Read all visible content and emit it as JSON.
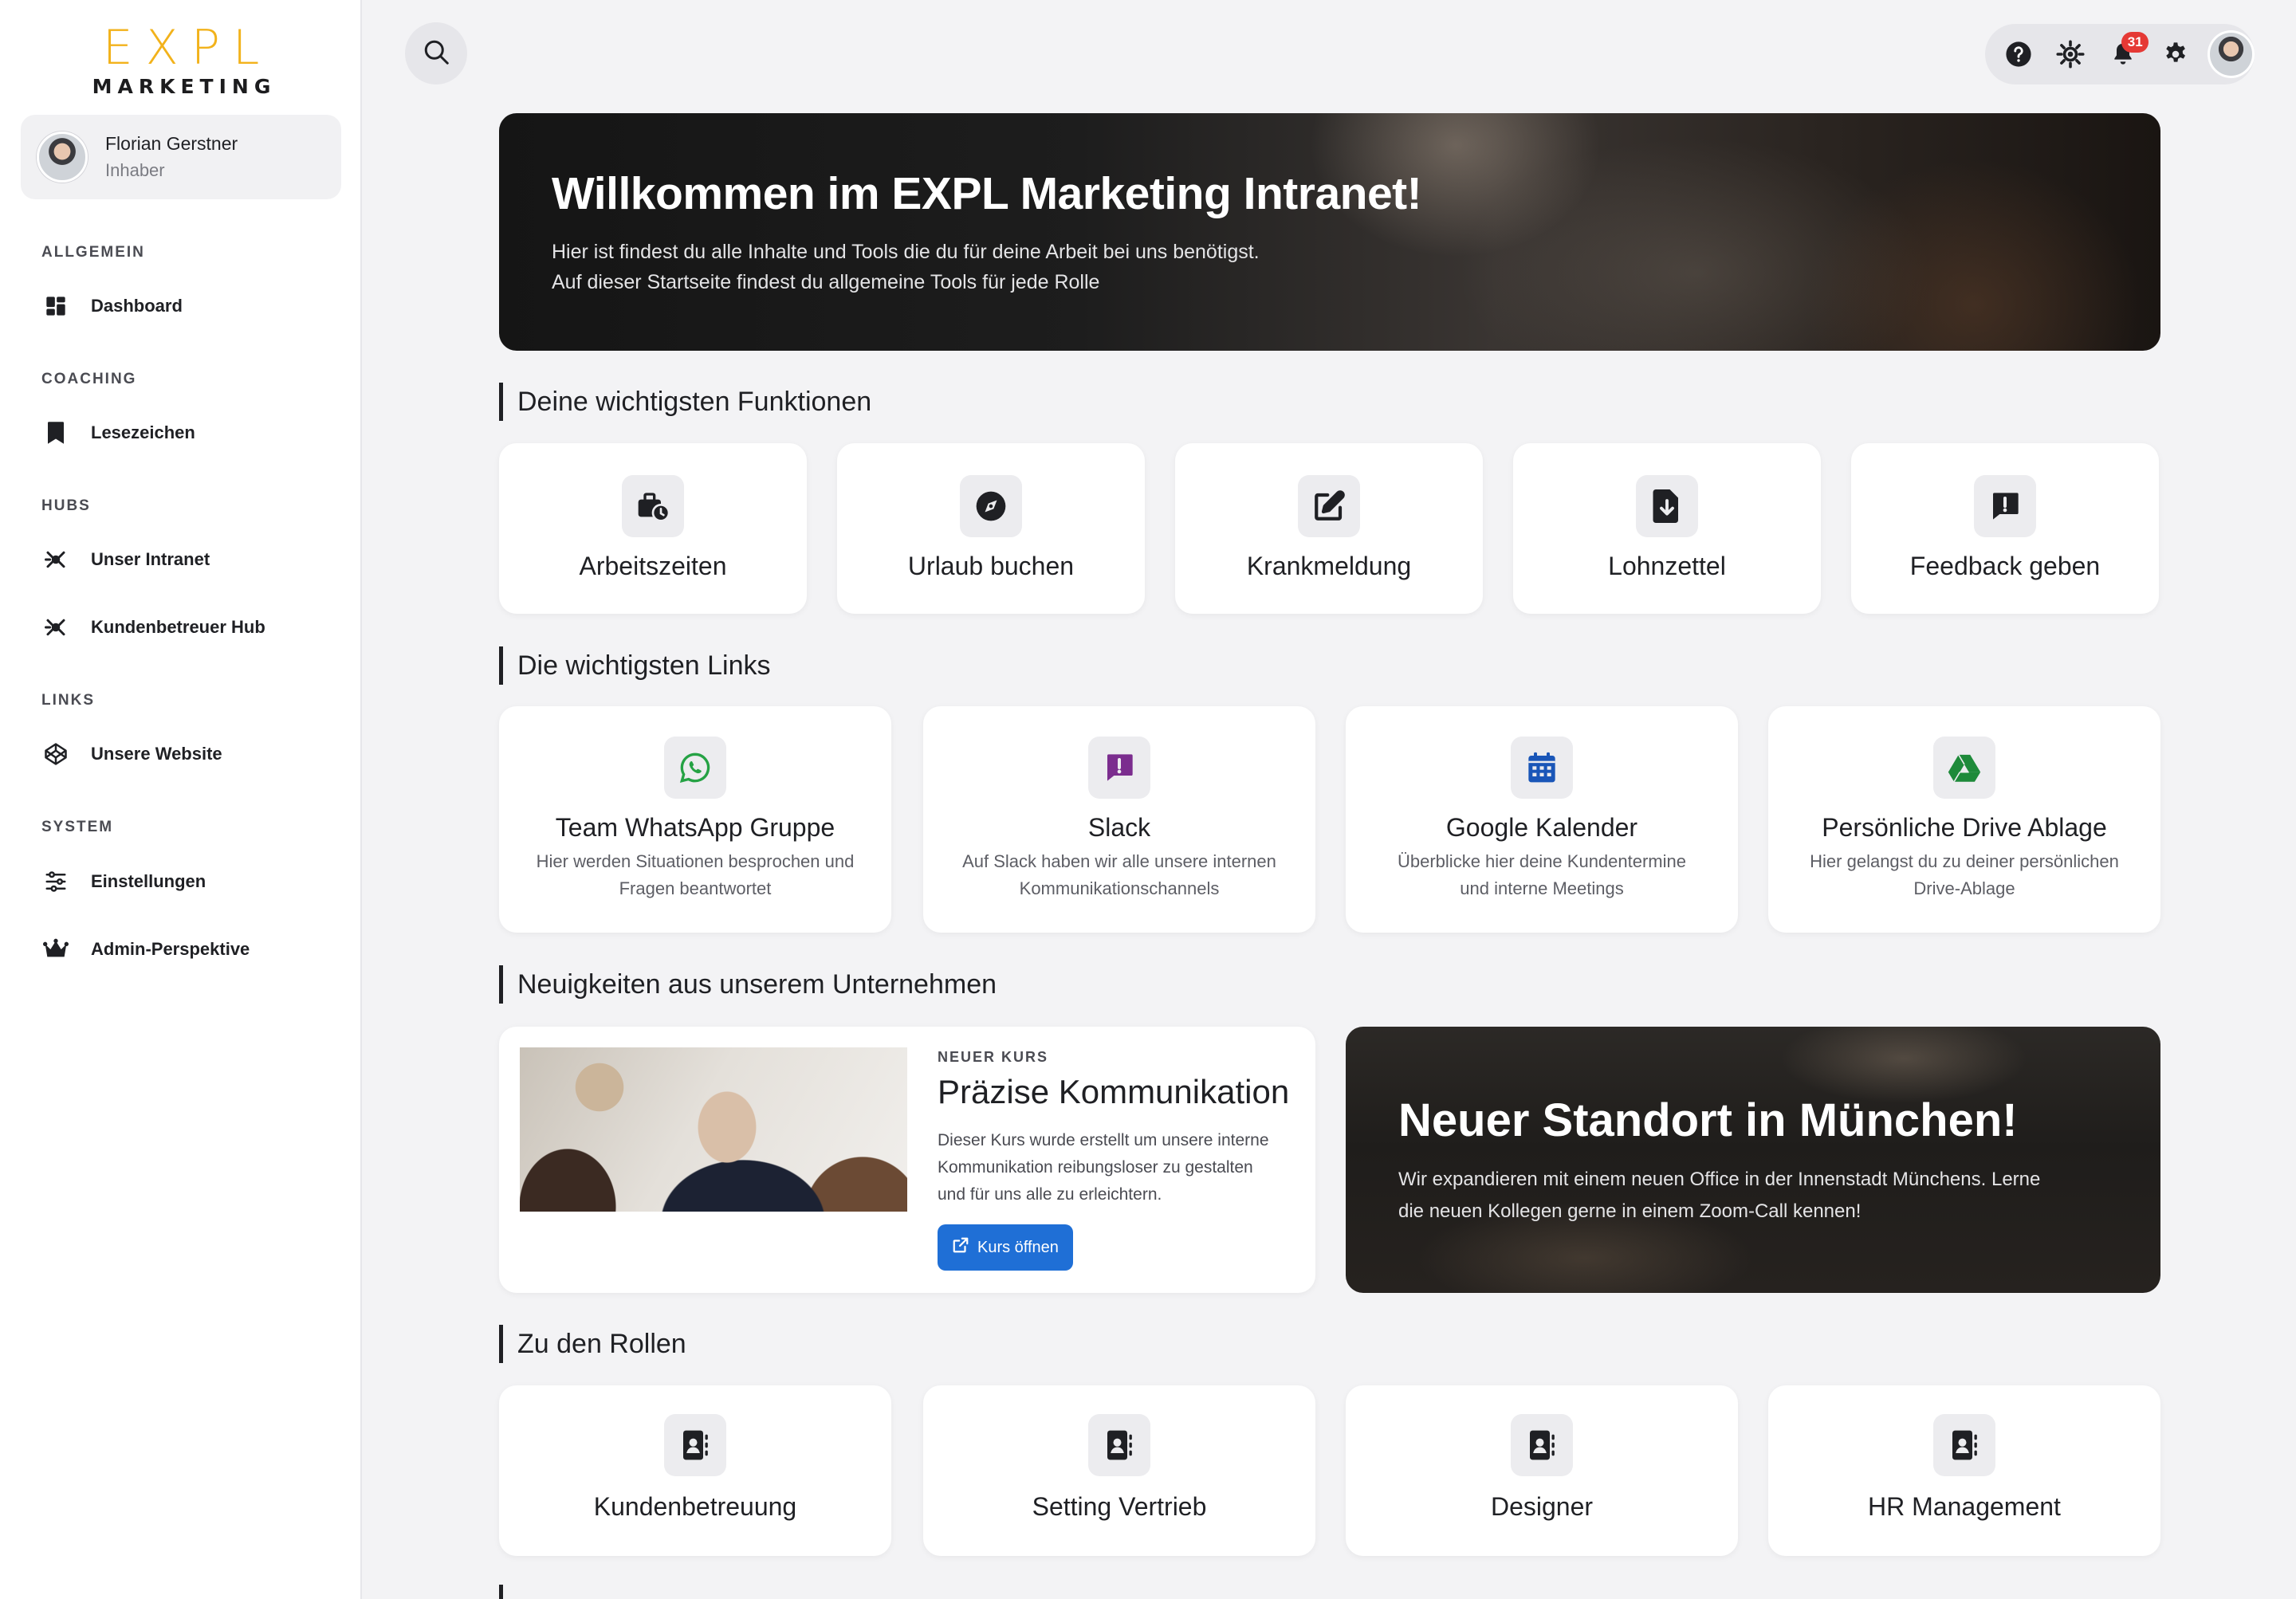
{
  "brand": {
    "logo_top": "EXPL",
    "logo_sub": "MARKETING",
    "accent": "#f2b21b"
  },
  "user": {
    "name": "Florian Gerstner",
    "role": "Inhaber"
  },
  "sidebar": {
    "sections": [
      {
        "title": "ALLGEMEIN",
        "items": [
          {
            "label": "Dashboard",
            "icon": "dashboard-icon"
          }
        ]
      },
      {
        "title": "COACHING",
        "items": [
          {
            "label": "Lesezeichen",
            "icon": "bookmark-icon"
          }
        ]
      },
      {
        "title": "HUBS",
        "items": [
          {
            "label": "Unser Intranet",
            "icon": "hub-icon"
          },
          {
            "label": "Kundenbetreuer Hub",
            "icon": "hub-icon"
          }
        ]
      },
      {
        "title": "LINKS",
        "items": [
          {
            "label": "Unsere Website",
            "icon": "codepen-icon"
          }
        ]
      },
      {
        "title": "SYSTEM",
        "items": [
          {
            "label": "Einstellungen",
            "icon": "sliders-icon"
          },
          {
            "label": "Admin-Perspektive",
            "icon": "crown-icon"
          }
        ]
      }
    ]
  },
  "topbar": {
    "notifications_count": "31"
  },
  "hero": {
    "title": "Willkommen im EXPL Marketing Intranet!",
    "line1": "Hier ist findest du alle Inhalte und Tools die du für deine Arbeit bei uns benötigst.",
    "line2": "Auf dieser Startseite findest du allgemeine Tools für jede Rolle"
  },
  "functions": {
    "title": "Deine wichtigsten Funktionen",
    "items": [
      {
        "label": "Arbeitszeiten",
        "icon": "briefcase-clock-icon"
      },
      {
        "label": "Urlaub buchen",
        "icon": "compass-icon"
      },
      {
        "label": "Krankmeldung",
        "icon": "edit-icon"
      },
      {
        "label": "Lohnzettel",
        "icon": "file-download-icon"
      },
      {
        "label": "Feedback geben",
        "icon": "message-alert-icon"
      }
    ]
  },
  "links": {
    "title": "Die wichtigsten Links",
    "items": [
      {
        "label": "Team WhatsApp Gruppe",
        "desc1": "Hier werden Situationen besprochen und",
        "desc2": "Fragen beantwortet",
        "icon": "whatsapp-icon",
        "color": "#25a244"
      },
      {
        "label": "Slack",
        "desc1": "Auf Slack haben wir alle unsere internen",
        "desc2": "Kommunikationschannels",
        "icon": "slack-message-icon",
        "color": "#7b2d8e"
      },
      {
        "label": "Google Kalender",
        "desc1": "Überblicke hier deine Kundentermine",
        "desc2": "und interne Meetings",
        "icon": "calendar-icon",
        "color": "#1a56b8"
      },
      {
        "label": "Persönliche Drive Ablage",
        "desc1": "Hier gelangst du zu deiner persönlichen",
        "desc2": "Drive-Ablage",
        "icon": "google-drive-icon",
        "color": "#1e8a3a"
      }
    ]
  },
  "news": {
    "title": "Neuigkeiten aus unserem Unternehmen",
    "course": {
      "kicker": "NEUER KURS",
      "title": "Präzise Kommunikation",
      "desc1": "Dieser Kurs wurde erstellt um unsere interne",
      "desc2": "Kommunikation reibungsloser zu gestalten",
      "desc3": "und für uns alle zu erleichtern.",
      "button": "Kurs öffnen",
      "button_color": "#1f6fd6"
    },
    "location": {
      "title": "Neuer Standort in München!",
      "desc1": "Wir expandieren mit einem neuen Office in der Innenstadt Münchens. Lerne",
      "desc2": "die neuen Kollegen gerne in einem Zoom-Call kennen!"
    }
  },
  "roles": {
    "title": "Zu den Rollen",
    "items": [
      {
        "label": "Kundenbetreuung",
        "icon": "contact-book-icon"
      },
      {
        "label": "Setting Vertrieb",
        "icon": "contact-book-icon"
      },
      {
        "label": "Designer",
        "icon": "contact-book-icon"
      },
      {
        "label": "HR Management",
        "icon": "contact-book-icon"
      }
    ]
  }
}
